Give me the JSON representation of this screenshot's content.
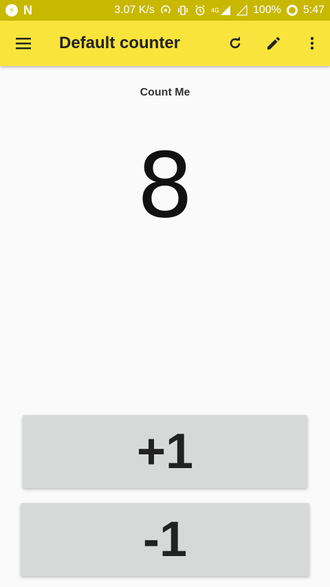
{
  "status_bar": {
    "speed": "3.07 K/s",
    "network": "4G",
    "battery": "100%",
    "time": "5:47"
  },
  "app_bar": {
    "title": "Default counter"
  },
  "counter": {
    "label": "Count Me",
    "value": "8"
  },
  "buttons": {
    "increment": "+1",
    "decrement": "-1"
  },
  "colors": {
    "status_bar": "#c9b800",
    "app_bar": "#f9e43c",
    "button_bg": "#d7d9d9",
    "background": "#fafafa"
  }
}
